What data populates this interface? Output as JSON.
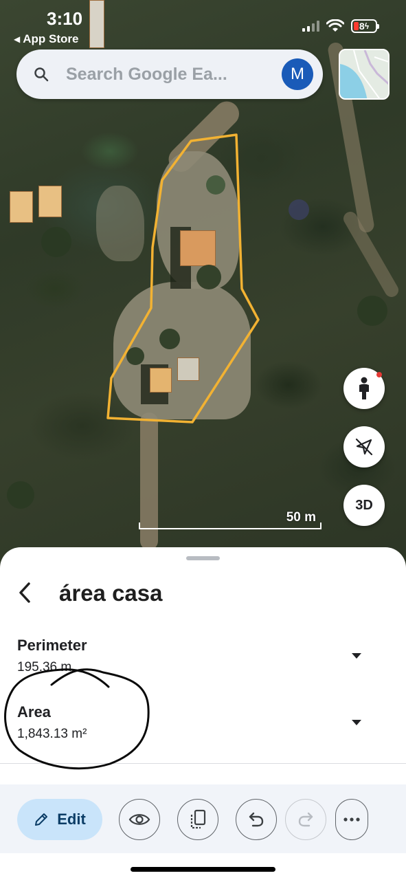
{
  "status_bar": {
    "time": "3:10",
    "back_app": "App Store",
    "battery_level": "8"
  },
  "search": {
    "placeholder": "Search Google Ea...",
    "avatar_initial": "M"
  },
  "map": {
    "scale_label": "50 m",
    "button_3d": "3D",
    "polygon_color": "#f2b233"
  },
  "sheet": {
    "title": "área casa",
    "perimeter_label": "Perimeter",
    "perimeter_value": "195.36 m",
    "area_label": "Area",
    "area_value": "1,843.13 m²"
  },
  "toolbar": {
    "edit_label": "Edit",
    "buttons": [
      "eye-icon",
      "copy-icon",
      "undo-icon",
      "redo-icon",
      "more-icon"
    ]
  },
  "colors": {
    "accent": "#1a5bb8",
    "edit_bg": "#c9e4fa"
  }
}
